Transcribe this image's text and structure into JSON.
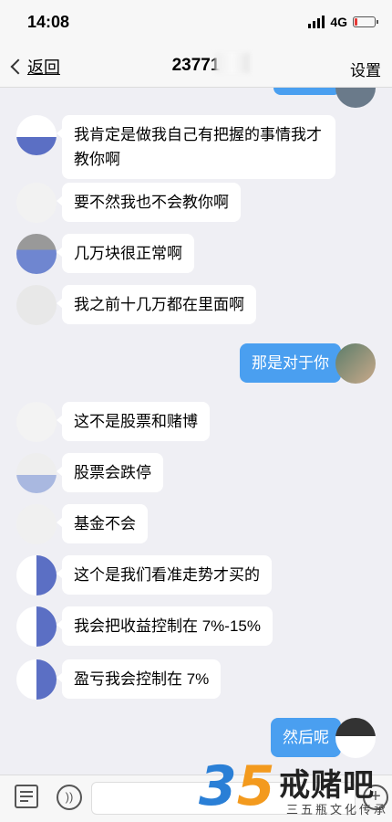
{
  "status_bar": {
    "time": "14:08",
    "network": "4G",
    "battery_level": 0.15,
    "battery_color": "#e53935"
  },
  "nav": {
    "back_label": "返回",
    "title": "23771",
    "settings_label": "设置"
  },
  "messages": [
    {
      "side": "left",
      "text": "我肯定是做我自己有把握的事情我才\n教你啊"
    },
    {
      "side": "left",
      "text": "要不然我也不会教你啊"
    },
    {
      "side": "left",
      "text": "几万块很正常啊"
    },
    {
      "side": "left",
      "text": "我之前十几万都在里面啊"
    },
    {
      "side": "right",
      "text": "那是对于你"
    },
    {
      "side": "left",
      "text": "这不是股票和赌博"
    },
    {
      "side": "left",
      "text": "股票会跌停"
    },
    {
      "side": "left",
      "text": "基金不会"
    },
    {
      "side": "left",
      "text": "这个是我们看准走势才买的"
    },
    {
      "side": "left",
      "text": "我会把收益控制在 7%-15%"
    },
    {
      "side": "left",
      "text": "盈亏我会控制在 7%"
    },
    {
      "side": "right",
      "text": "然后呢"
    }
  ],
  "watermark": {
    "number_a": "3",
    "number_b": "5",
    "title": "戒赌吧",
    "subtitle": "三五瓶文化传承"
  },
  "colors": {
    "bubble_blue": "#4a9ff0",
    "background": "#efeff4"
  }
}
